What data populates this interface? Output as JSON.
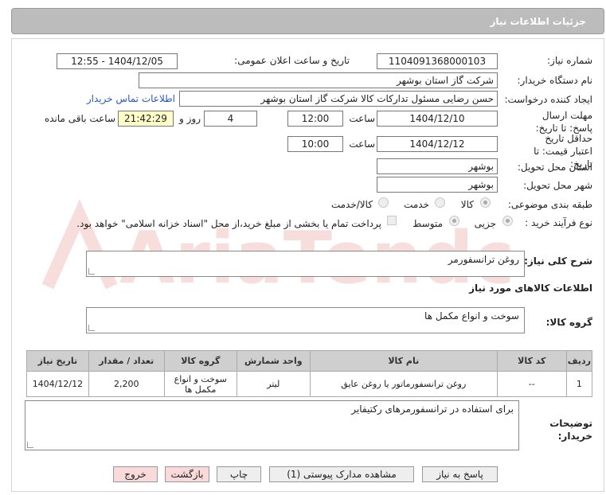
{
  "header": {
    "title": "جزئیات اطلاعات نیاز"
  },
  "labels": {
    "need_number": "شماره نیاز:",
    "announce_datetime": "تاریخ و ساعت اعلان عمومی:",
    "buyer_org": "نام دستگاه خریدار:",
    "requester": "ایجاد کننده درخواست:",
    "reply_deadline": "مهلت ارسال پاسخ: تا تاریخ:",
    "price_validity": "حداقل تاریخ اعتبار قیمت: تا تاریخ:",
    "time": "ساعت",
    "day_and": "روز و",
    "remaining": "ساعت باقی مانده",
    "province": "استان محل تحویل:",
    "city": "شهر محل تحویل:",
    "category": "طبقه بندی موضوعی:",
    "purchase_type": "نوع فرآیند خرید :",
    "description": "شرح کلی نیاز:",
    "goods_info": "اطلاعات کالاهای مورد نیاز",
    "goods_group": "گروه کالا:",
    "buyer_notes": "توضیحات خریدار:"
  },
  "values": {
    "need_number": "1104091368000103",
    "announce_datetime": "1404/12/05 - 12:55",
    "buyer_org": "شرکت گاز استان بوشهر",
    "requester": "حسن رضایی مسئول تدارکات کالا شرکت گاز استان بوشهر",
    "contact_link": "اطلاعات تماس خریدار",
    "reply_date": "1404/12/10",
    "reply_time": "12:00",
    "days": "4",
    "remaining_time": "21:42:29",
    "validity_date": "1404/12/12",
    "validity_time": "10:00",
    "province": "بوشهر",
    "city": "بوشهر",
    "description": "روغن ترانسفورمر",
    "goods_group": "سوخت و انواع مکمل ها",
    "buyer_notes": "برای استفاده در ترانسفورمرهای رکتیفایر"
  },
  "category_options": [
    "کالا",
    "خدمت",
    "کالا/خدمت"
  ],
  "category_selected": "کالا",
  "purchase_options": [
    "جزیی",
    "متوسط"
  ],
  "purchase_selected": "جزیی",
  "payment_note": "پرداخت تمام یا بخشی از مبلغ خرید،از محل \"اسناد خزانه اسلامی\" خواهد بود.",
  "table": {
    "headers": [
      "ردیف",
      "کد کالا",
      "نام کالا",
      "واحد شمارش",
      "گروه کالا",
      "تعداد / مقدار",
      "تاریخ نیاز"
    ],
    "rows": [
      [
        "1",
        "--",
        "روغن ترانسفورماتور یا روغن عایق",
        "لیتر",
        "سوخت و انواع مکمل ها",
        "2,200",
        "1404/12/12"
      ]
    ]
  },
  "buttons": {
    "reply": "پاسخ به نیاز",
    "attachments": "مشاهده مدارک پیوستی (1)",
    "print": "چاپ",
    "back": "بازگشت",
    "exit": "خروج"
  },
  "watermark": "AriaTender.net"
}
